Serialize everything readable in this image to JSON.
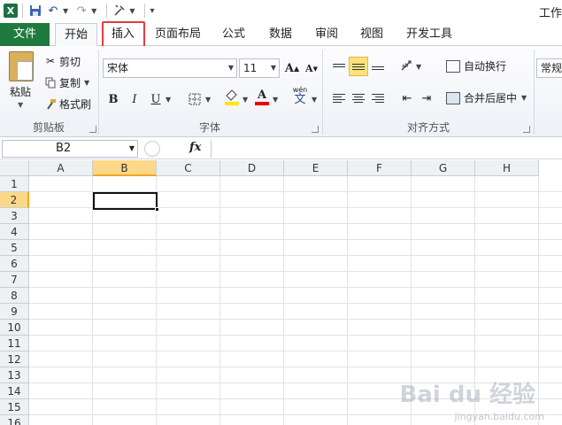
{
  "title_bar": {
    "app_icon": "X",
    "title_partial": "工作"
  },
  "tabs": {
    "file": "文件",
    "home": "开始",
    "insert": "插入",
    "page_layout": "页面布局",
    "formulas": "公式",
    "data": "数据",
    "review": "审阅",
    "view": "视图",
    "developer": "开发工具"
  },
  "clipboard": {
    "paste": "粘贴",
    "cut": "剪切",
    "copy": "复制",
    "format_painter": "格式刷",
    "label": "剪贴板"
  },
  "font": {
    "name": "宋体",
    "size": "11",
    "grow": "A",
    "shrink": "A",
    "bold": "B",
    "italic": "I",
    "underline": "U",
    "font_color_letter": "A",
    "phonetic_char": "文",
    "phonetic_top": "wén",
    "label": "字体"
  },
  "alignment": {
    "wrap_text": "自动换行",
    "merge_center": "合并后居中",
    "label": "对齐方式"
  },
  "number": {
    "format": "常规"
  },
  "formula_bar": {
    "name_box": "B2",
    "fx": "fx",
    "formula": ""
  },
  "grid": {
    "columns": [
      "A",
      "B",
      "C",
      "D",
      "E",
      "F",
      "G",
      "H"
    ],
    "rows": [
      "1",
      "2",
      "3",
      "4",
      "5",
      "6",
      "7",
      "8",
      "9",
      "10",
      "11",
      "12",
      "13",
      "14",
      "15",
      "16"
    ],
    "selected_column": "B",
    "selected_row": "2"
  },
  "watermark": {
    "main": "Bai du 经验",
    "sub": "jingyan.baidu.com"
  },
  "colors": {
    "file_tab": "#1f7a3e",
    "highlight": "#e53a3a",
    "selected_header": "#fbd889"
  }
}
